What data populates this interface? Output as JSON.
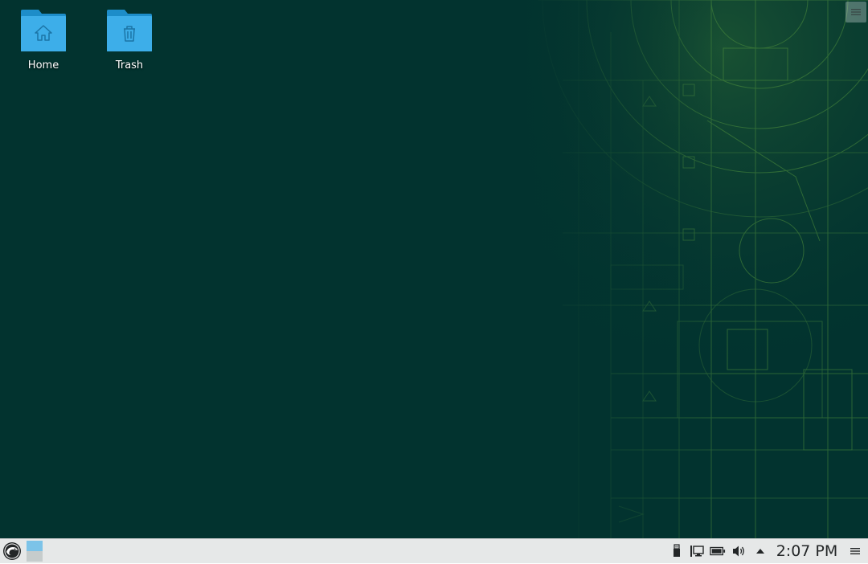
{
  "desktop": {
    "background_color": "#02332f",
    "accent_color": "#73ba25",
    "icons": [
      {
        "label": "Home",
        "icon": "home-folder-icon"
      },
      {
        "label": "Trash",
        "icon": "trash-folder-icon"
      }
    ],
    "toolbox_icon": "hamburger-menu-icon"
  },
  "taskbar": {
    "background_color": "#e6e8e8",
    "launcher_icon": "opensuse-chameleon-icon",
    "pager": {
      "desktops": 2,
      "active": 1
    },
    "tray_icons": [
      "usb-device-icon",
      "network-icon",
      "battery-icon",
      "volume-icon",
      "expand-tray-arrow-icon"
    ],
    "clock": "2:07 PM",
    "menu_icon": "hamburger-menu-icon"
  }
}
